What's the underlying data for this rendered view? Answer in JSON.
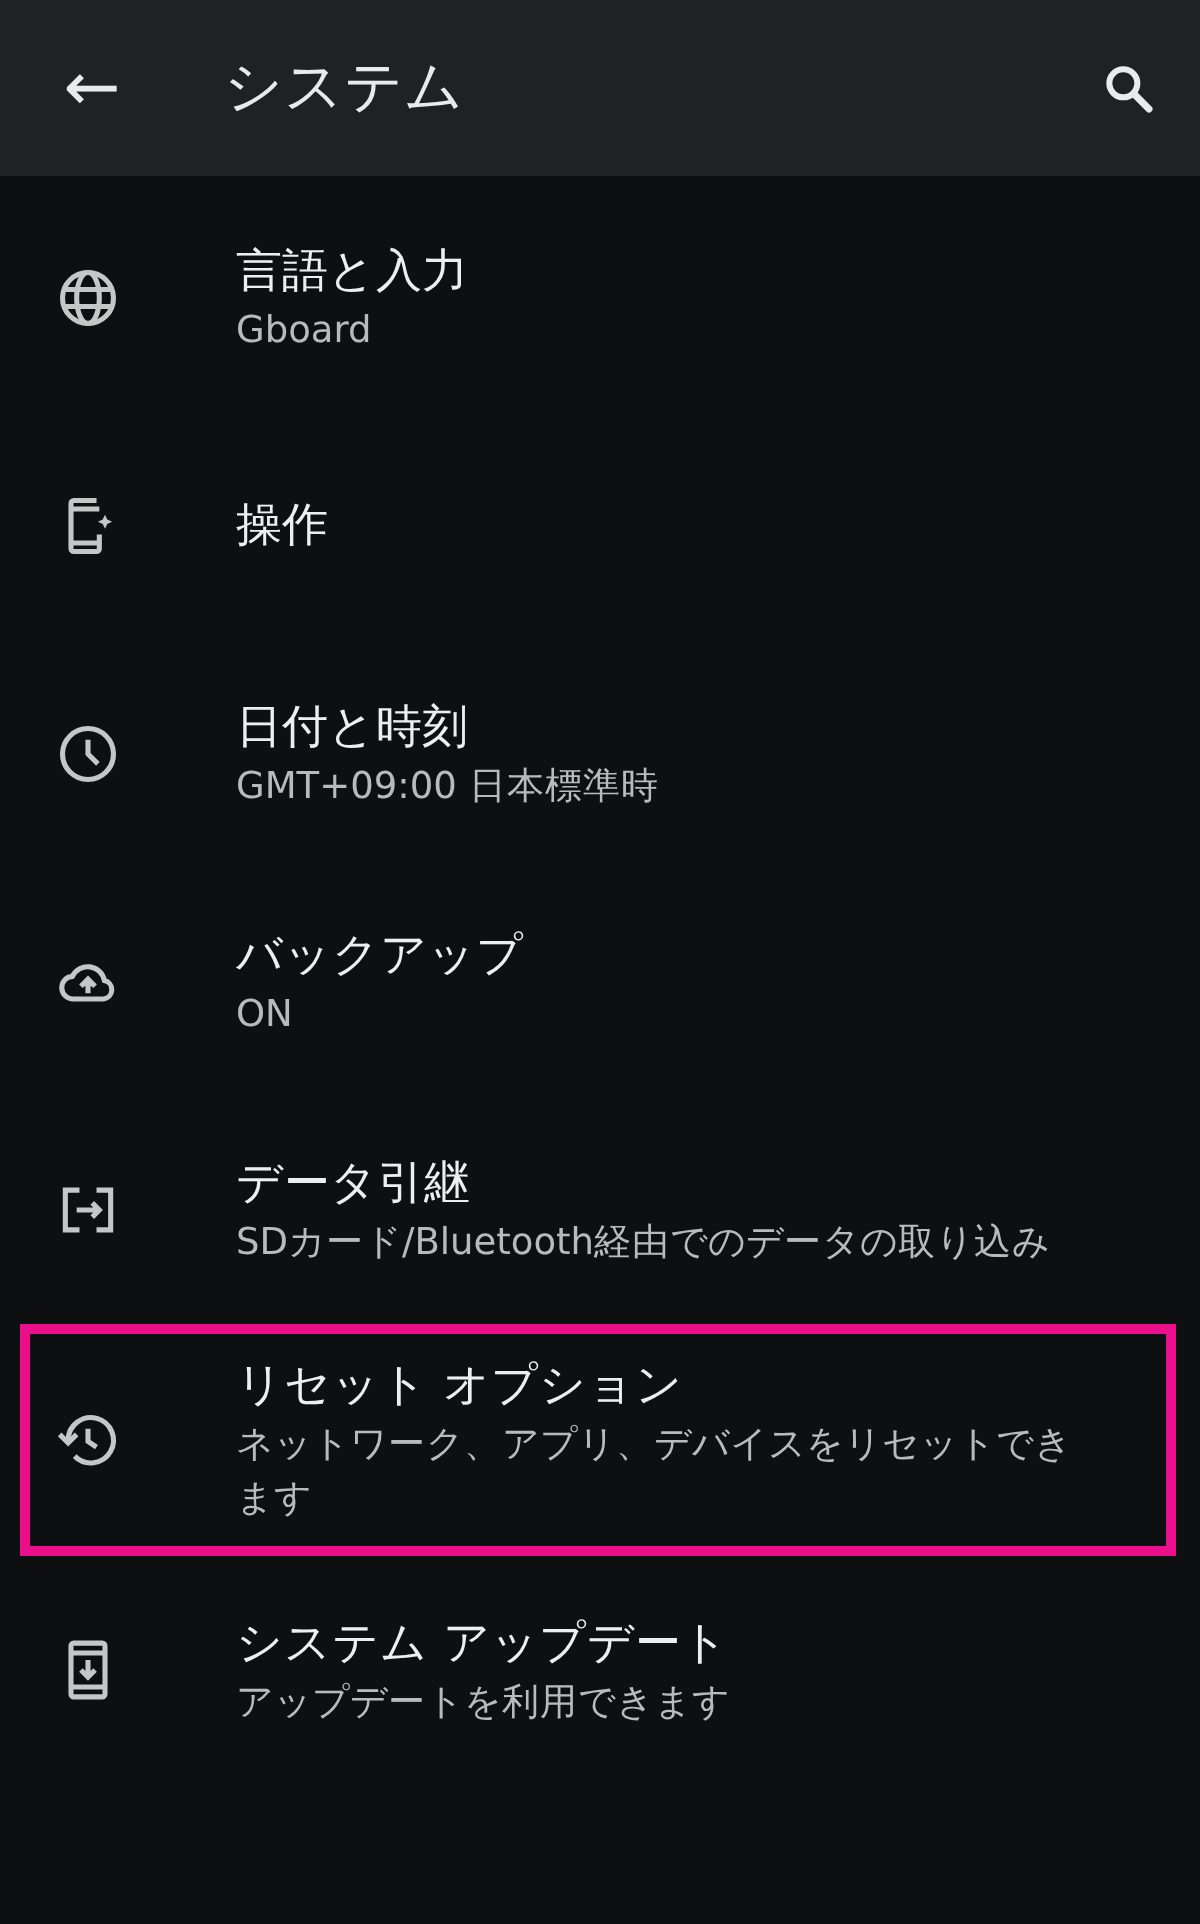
{
  "app_bar": {
    "back_icon": "←",
    "title": "システム"
  },
  "items": [
    {
      "title": "言語と入力",
      "subtitle": "Gboard",
      "highlighted": false
    },
    {
      "title": "操作",
      "highlighted": false
    },
    {
      "title": "日付と時刻",
      "subtitle": "GMT+09:00 日本標準時",
      "highlighted": false
    },
    {
      "title": "バックアップ",
      "subtitle": "ON",
      "highlighted": false
    },
    {
      "title": "データ引継",
      "subtitle": "SDカード/Bluetooth経由でのデータの取り込み",
      "highlighted": false
    },
    {
      "title": "リセット オプション",
      "subtitle": "ネットワーク、アプリ、デバイスをリセットできます",
      "highlighted": true
    },
    {
      "title": "システム アップデート",
      "subtitle": "アップデートを利用できます",
      "highlighted": false
    }
  ]
}
